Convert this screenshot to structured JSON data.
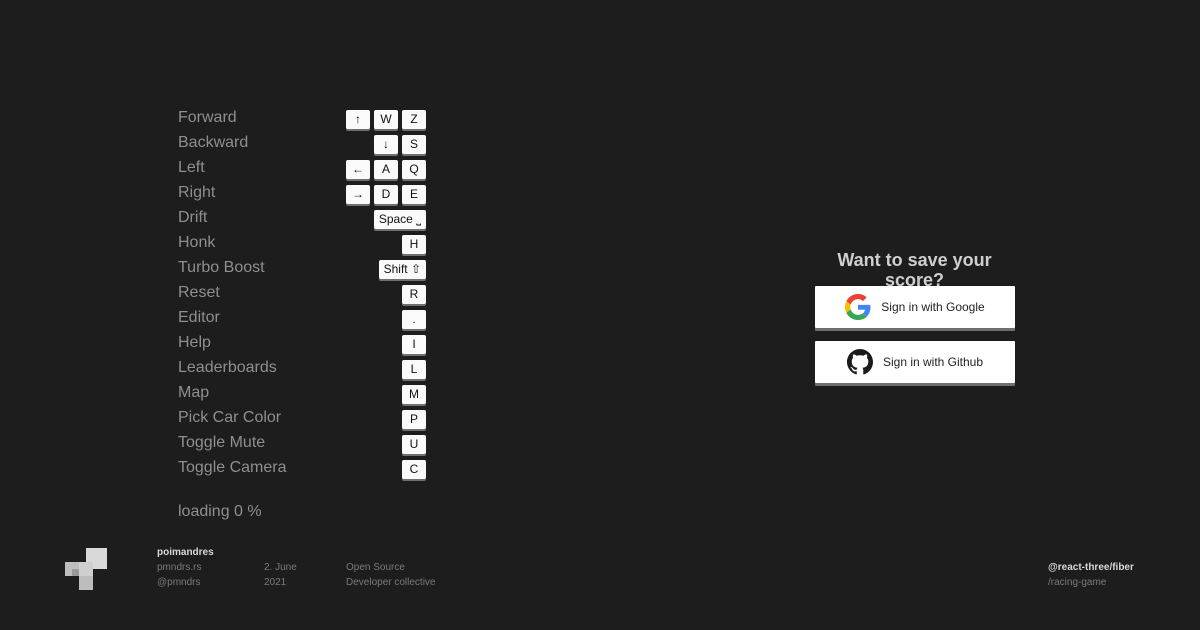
{
  "controls": [
    {
      "action": "Forward",
      "keys": [
        "↑",
        "W",
        "Z"
      ]
    },
    {
      "action": "Backward",
      "keys": [
        "↓",
        "S"
      ]
    },
    {
      "action": "Left",
      "keys": [
        "←",
        "A",
        "Q"
      ]
    },
    {
      "action": "Right",
      "keys": [
        "→",
        "D",
        "E"
      ]
    },
    {
      "action": "Drift",
      "keys": [
        "Space ⎵"
      ]
    },
    {
      "action": "Honk",
      "keys": [
        "H"
      ]
    },
    {
      "action": "Turbo Boost",
      "keys": [
        "Shift ⇧"
      ]
    },
    {
      "action": "Reset",
      "keys": [
        "R"
      ]
    },
    {
      "action": "Editor",
      "keys": [
        "."
      ]
    },
    {
      "action": "Help",
      "keys": [
        "I"
      ]
    },
    {
      "action": "Leaderboards",
      "keys": [
        "L"
      ]
    },
    {
      "action": "Map",
      "keys": [
        "M"
      ]
    },
    {
      "action": "Pick Car Color",
      "keys": [
        "P"
      ]
    },
    {
      "action": "Toggle Mute",
      "keys": [
        "U"
      ]
    },
    {
      "action": "Toggle Camera",
      "keys": [
        "C"
      ]
    }
  ],
  "loading": "loading 0 %",
  "auth": {
    "title": "Want to save your score?",
    "google_label": "Sign in with Google",
    "github_label": "Sign in with Github",
    "google_icon": "google-icon",
    "github_icon": "github-icon"
  },
  "footer": {
    "brand": "poimandres",
    "site": "pmndrs.rs",
    "handle": "@pmndrs",
    "date_day": "2. June",
    "date_year": "2021",
    "tag1": "Open Source",
    "tag2": "Developer collective",
    "project": "@react-three/fiber",
    "repo": "/racing-game"
  }
}
